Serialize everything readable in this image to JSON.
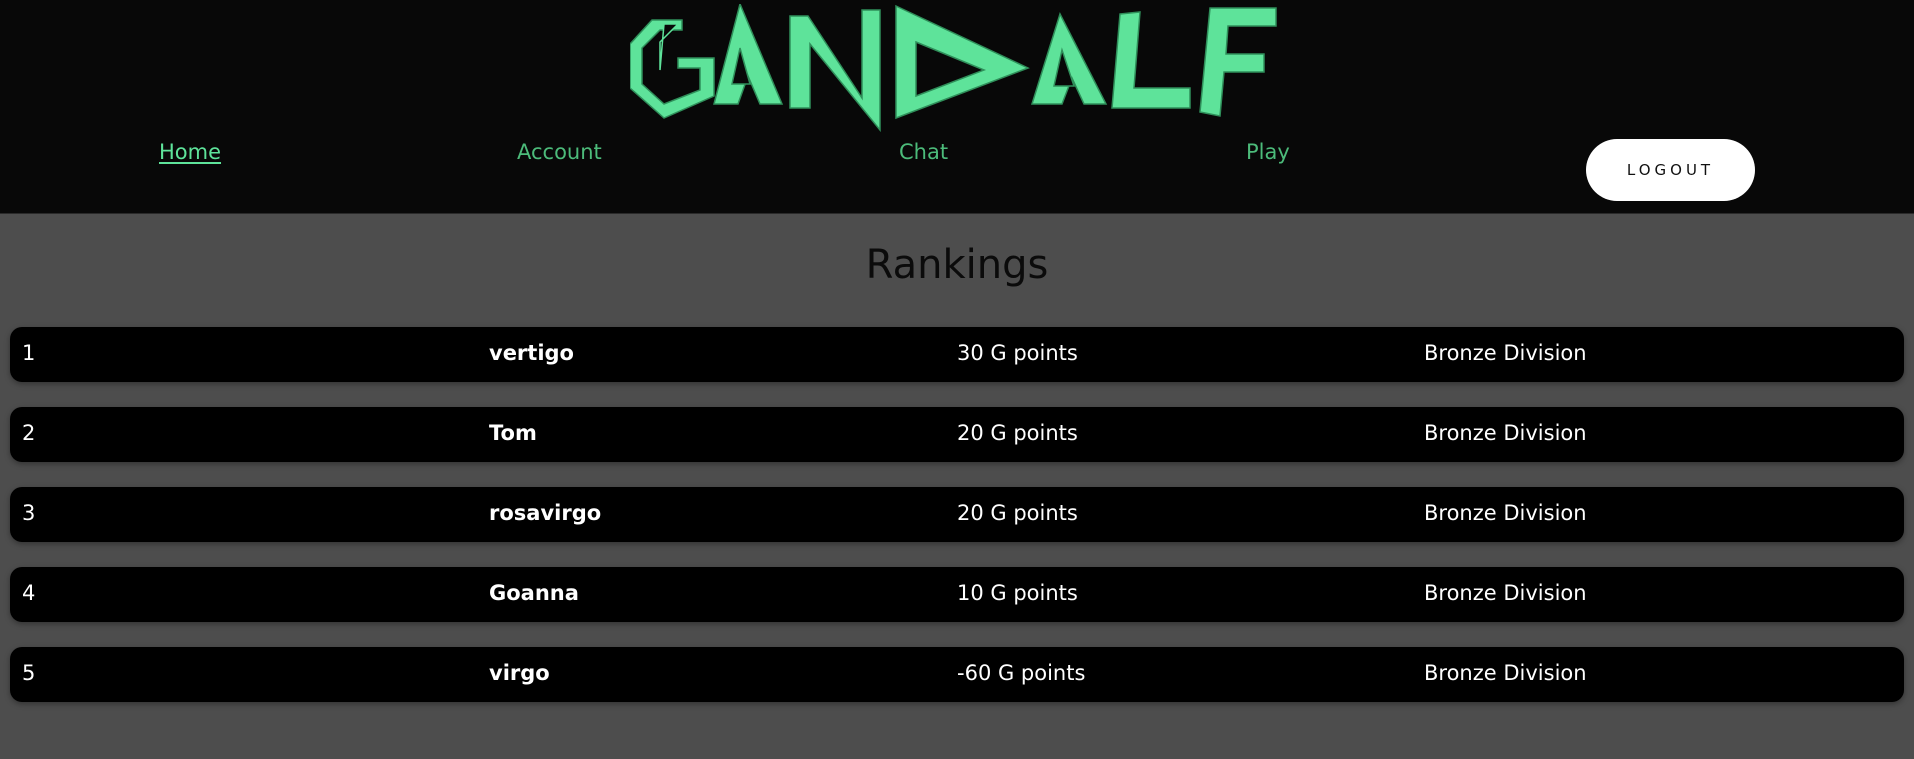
{
  "logo": {
    "text": "GANDALF",
    "color": "#5ee39a"
  },
  "nav": {
    "home": "Home",
    "account": "Account",
    "chat": "Chat",
    "play": "Play",
    "logout": "LOGOUT"
  },
  "main": {
    "title": "Rankings",
    "rows": [
      {
        "rank": "1",
        "name": "vertigo",
        "points": "30 G points",
        "division": "Bronze Division"
      },
      {
        "rank": "2",
        "name": "Tom",
        "points": "20 G points",
        "division": "Bronze Division"
      },
      {
        "rank": "3",
        "name": "rosavirgo",
        "points": "20 G points",
        "division": "Bronze Division"
      },
      {
        "rank": "4",
        "name": "Goanna",
        "points": "10 G points",
        "division": "Bronze Division"
      },
      {
        "rank": "5",
        "name": "virgo",
        "points": "-60 G points",
        "division": "Bronze Division"
      }
    ]
  },
  "colors": {
    "header_bg": "#080808",
    "page_bg": "#4d4d4d",
    "accent_green": "#4cbb7a",
    "row_bg": "#000000"
  }
}
